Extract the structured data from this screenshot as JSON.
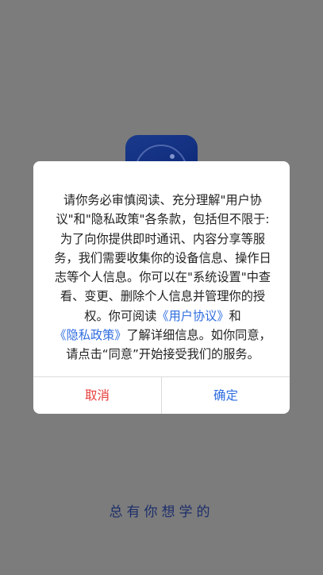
{
  "splash": {
    "slogan": "总有你想学的"
  },
  "dialog": {
    "text_1": "请你务必审慎阅读、充分理解\"用户协议\"和\"隐私政策\"各条款，包括但不限于:为了向你提供即时通讯、内容分享等服务，我们需要收集你的设备信息、操作日志等个人信息。你可以在\"系统设置\"中查看、变更、删除个人信息并管理你的授权。你可阅读",
    "user_agreement_link": "《用户协议》",
    "text_and": "和",
    "privacy_policy_link": "《隐私政策》",
    "text_2": "了解详细信息。如你同意，请点击“同意”开始接受我们的服务。",
    "cancel_label": "取消",
    "confirm_label": "确定"
  },
  "colors": {
    "overlay": "#7c7c7c",
    "link": "#2d6cdf",
    "cancel": "#e53935",
    "confirm": "#2d6cdf",
    "slogan": "#1c2e6a"
  }
}
